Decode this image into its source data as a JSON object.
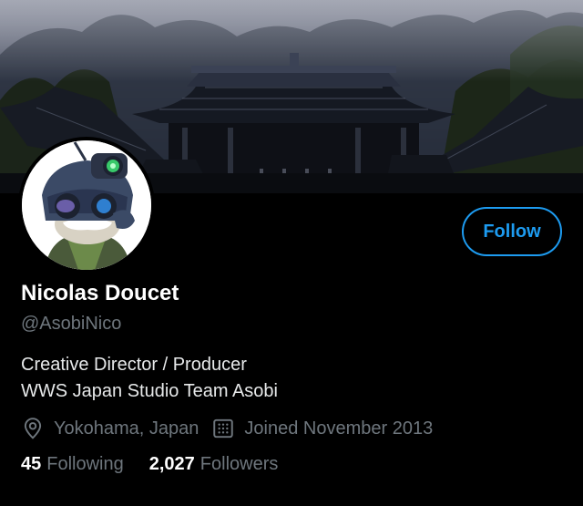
{
  "banner": {
    "image": "misty-japanese-shrine-photo"
  },
  "avatar": {
    "image": "cartoon-character-with-night-vision-goggles"
  },
  "follow_button": {
    "label": "Follow"
  },
  "profile": {
    "display_name": "Nicolas Doucet",
    "handle": "@AsobiNico",
    "bio_lines": [
      "Creative Director / Producer",
      "WWS Japan Studio Team Asobi"
    ],
    "location": "Yokohama, Japan",
    "joined": "Joined November 2013"
  },
  "stats": {
    "following_count": "45",
    "following_label": "Following",
    "followers_count": "2,027",
    "followers_label": "Followers"
  },
  "icons": {
    "location": "location-pin-icon",
    "calendar": "calendar-icon"
  },
  "colors": {
    "background": "#000000",
    "accent": "#1d9bf0",
    "secondary_text": "#6e767d",
    "primary_text": "#ffffff"
  }
}
